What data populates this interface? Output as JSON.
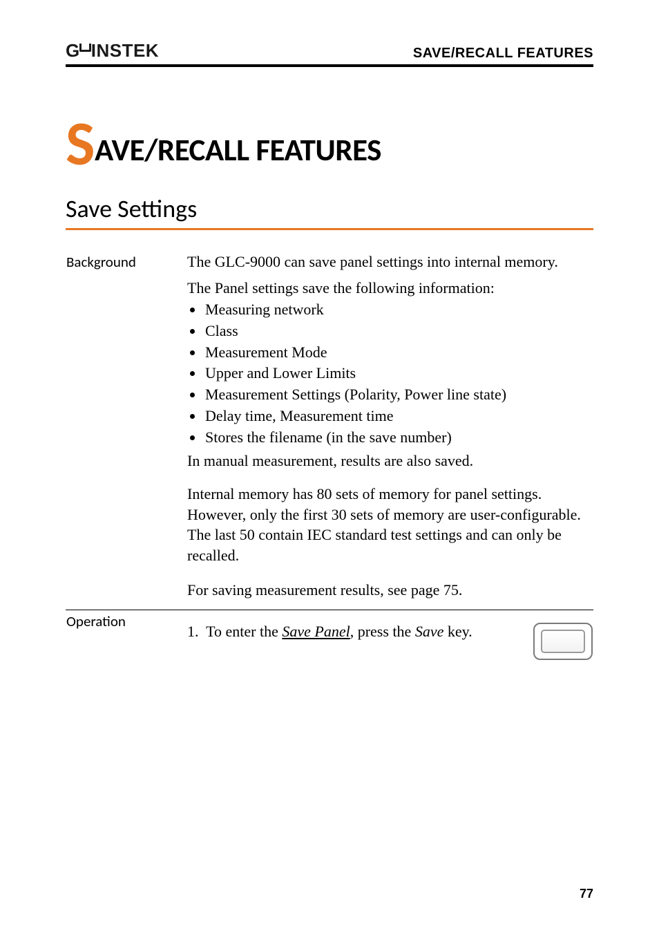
{
  "header": {
    "brand_text": "INSTEK",
    "brand_prefix": "G",
    "right": "SAVE/RECALL FEATURES"
  },
  "chapter": {
    "drop_cap": "S",
    "rest": "AVE/RECALL FEATURES"
  },
  "section_title": "Save Settings",
  "background": {
    "label": "Background",
    "intro": "The GLC-9000 can save panel settings into internal memory.",
    "lead": "The Panel settings save the following information:",
    "bullets": [
      "Measuring network",
      "Class",
      "Measurement Mode",
      "Upper and Lower Limits",
      "Measurement Settings (Polarity, Power line state)",
      "Delay time, Measurement time",
      "Stores the filename (in the save number)"
    ],
    "after_bullets": "In manual measurement, results are also saved.",
    "para2": "Internal memory has 80 sets of memory for panel settings. However, only the first 30 sets of memory are user-configurable. The last 50 contain IEC standard test settings and can only be recalled.",
    "para3": "For saving measurement results, see page 75."
  },
  "operation": {
    "label": "Operation",
    "step_number": "1.",
    "step_pre": "To enter the ",
    "step_link": "Save Panel",
    "step_mid": ", press the ",
    "step_key": "Save",
    "step_post": " key."
  },
  "page_number": "77"
}
